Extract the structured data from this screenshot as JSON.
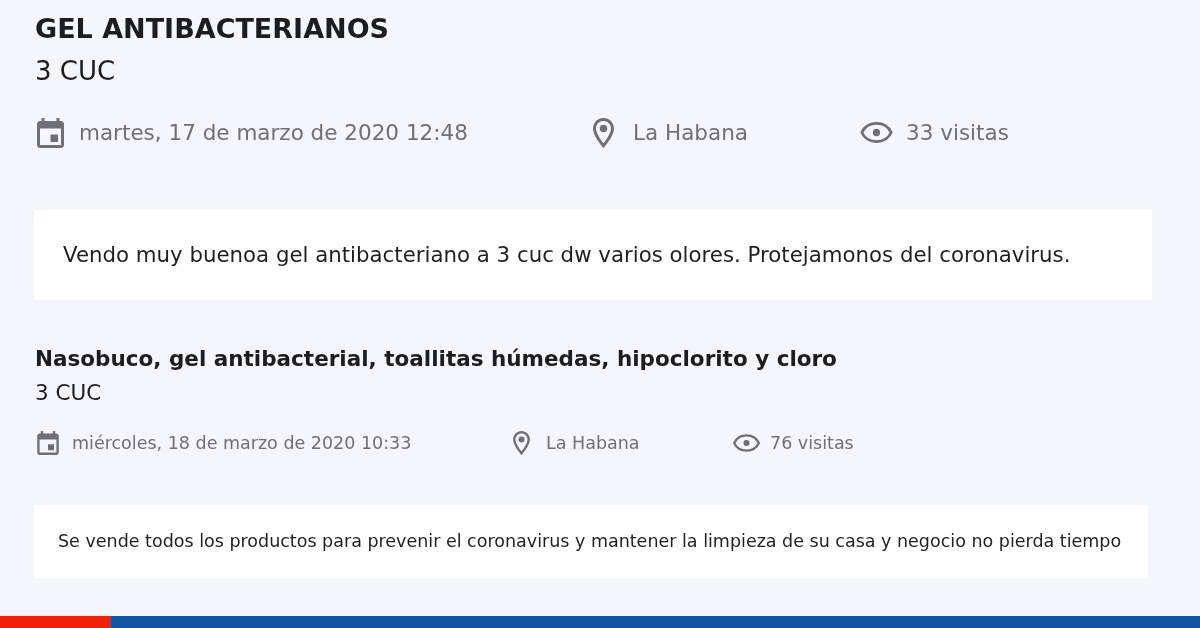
{
  "listings": [
    {
      "title": "GEL ANTIBACTERIANOS",
      "price": "3 CUC",
      "date": "martes, 17 de marzo de 2020 12:48",
      "location": "La Habana",
      "views": "33 visitas",
      "description": "Vendo muy buenoa gel antibacteriano a 3 cuc dw varios olores. Protejamonos del coronavirus."
    },
    {
      "title": "Nasobuco, gel antibacterial, toallitas húmedas, hipoclorito y cloro",
      "price": "3 CUC",
      "date": "miércoles, 18 de marzo de 2020 10:33",
      "location": "La Habana",
      "views": "76 visitas",
      "description": "Se vende todos los productos para prevenir el coronavirus y mantener la limpieza de su casa y negocio no pierda tiempo"
    }
  ]
}
